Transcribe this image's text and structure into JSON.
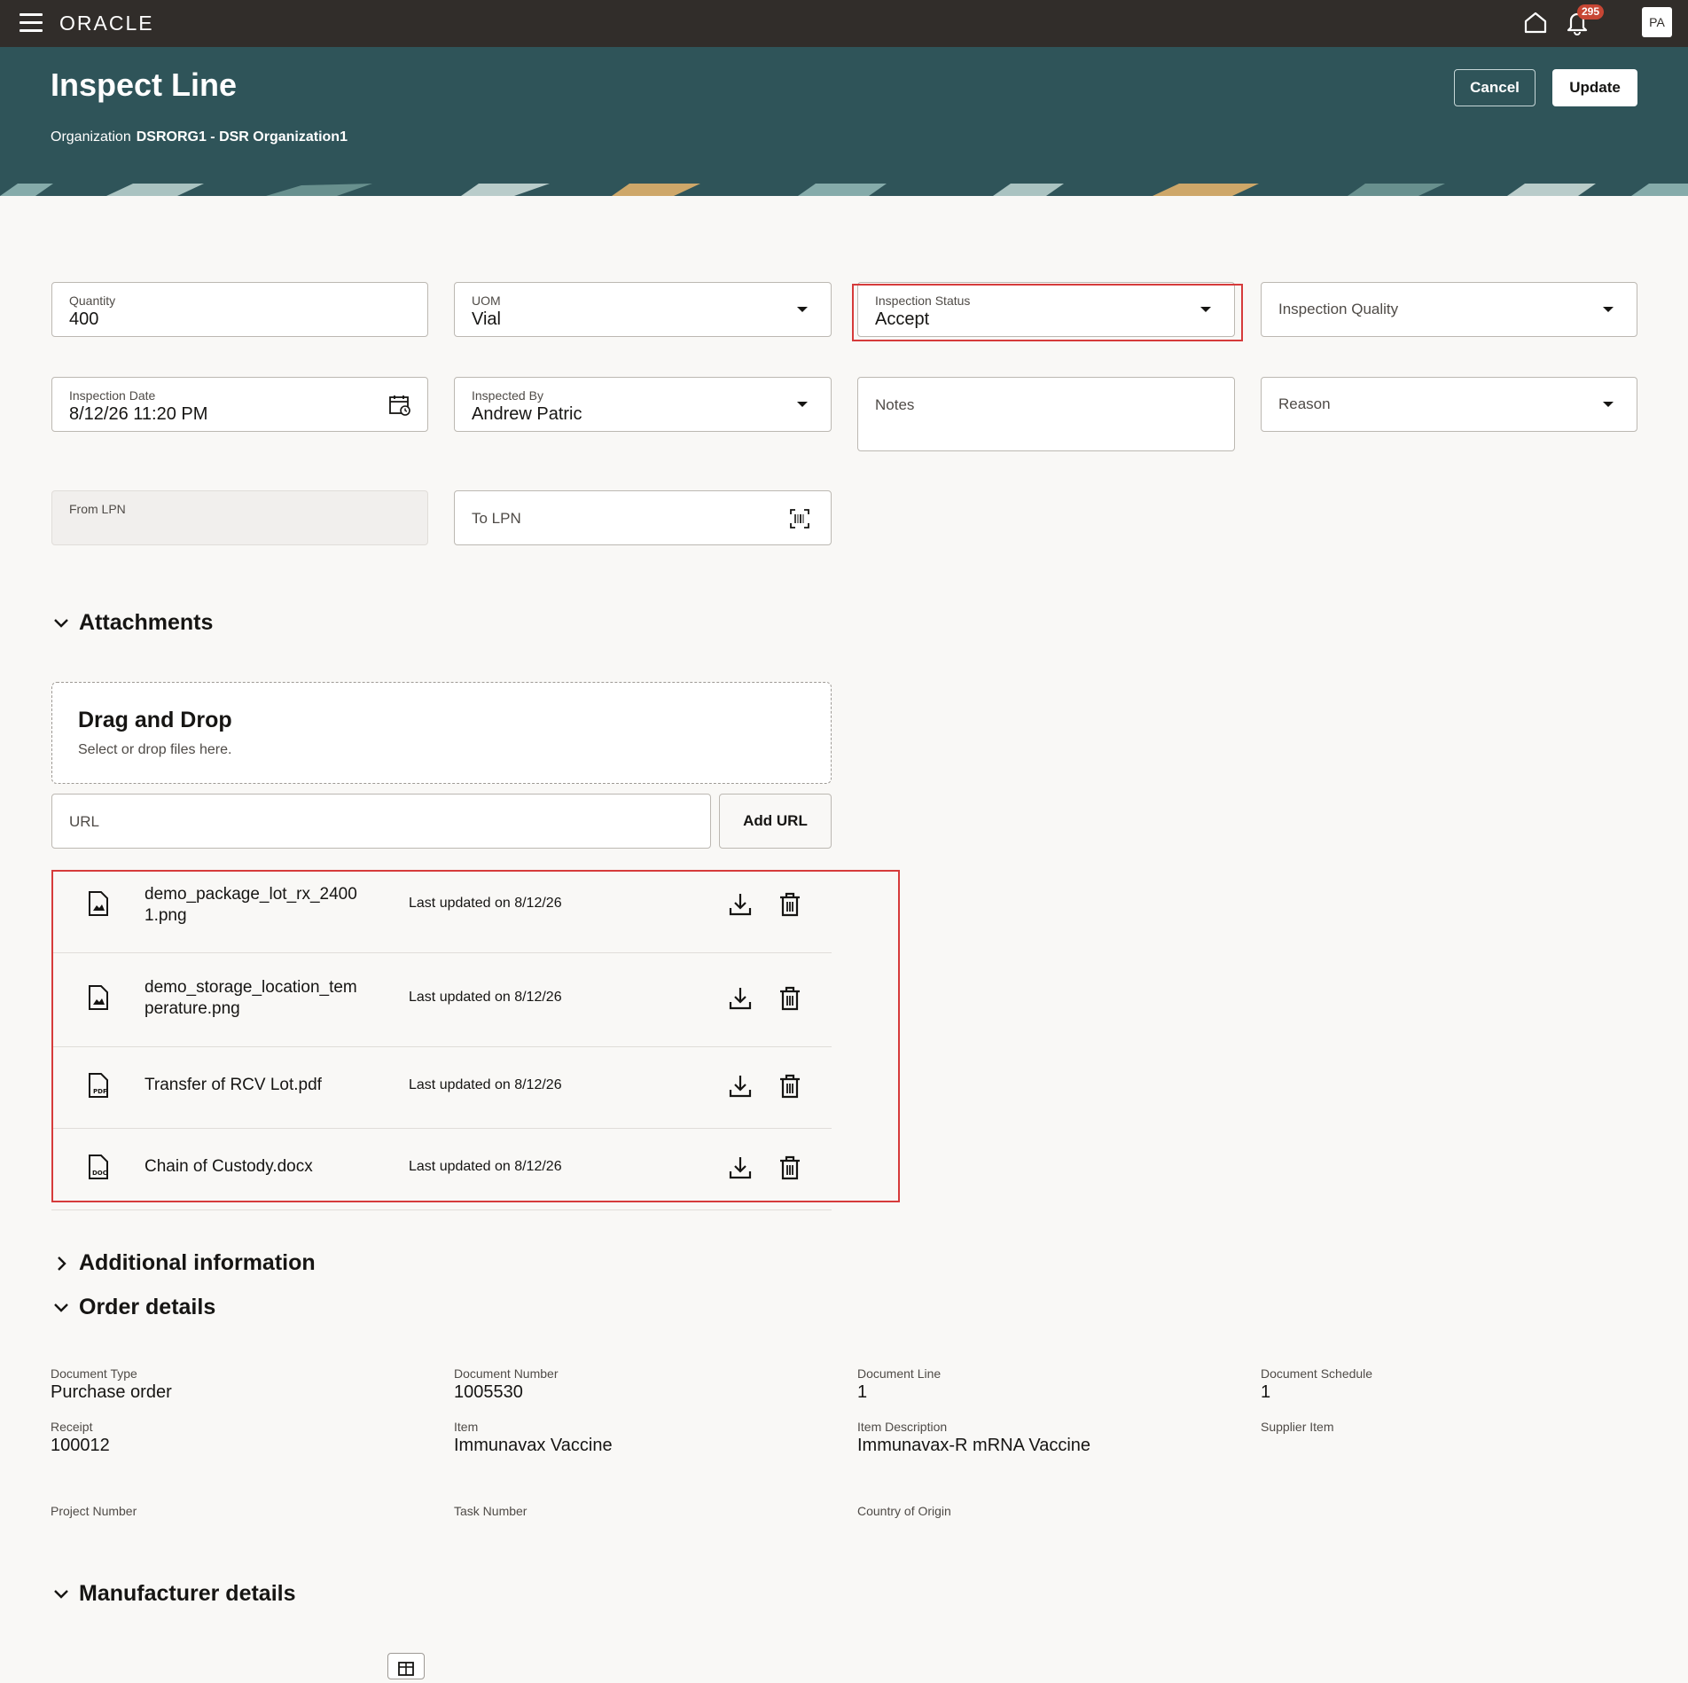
{
  "app": {
    "brand": "ORACLE",
    "notification_count": "295",
    "user_initials": "PA"
  },
  "header": {
    "title": "Inspect Line",
    "org_label": "Organization",
    "org_value": "DSRORG1 - DSR Organization1",
    "cancel_label": "Cancel",
    "update_label": "Update"
  },
  "form": {
    "quantity": {
      "label": "Quantity",
      "value": "400"
    },
    "uom": {
      "label": "UOM",
      "value": "Vial"
    },
    "inspection_status": {
      "label": "Inspection Status",
      "value": "Accept"
    },
    "inspection_quality": {
      "placeholder": "Inspection Quality"
    },
    "inspection_date": {
      "label": "Inspection Date",
      "value": "8/12/26 11:20 PM"
    },
    "inspected_by": {
      "label": "Inspected By",
      "value": "Andrew Patric"
    },
    "notes": {
      "placeholder": "Notes"
    },
    "reason": {
      "placeholder": "Reason"
    },
    "from_lpn": {
      "label": "From LPN"
    },
    "to_lpn": {
      "placeholder": "To LPN"
    }
  },
  "attachments": {
    "title": "Attachments",
    "drop_title": "Drag and Drop",
    "drop_subtitle": "Select or drop files here.",
    "url_placeholder": "URL",
    "add_url_label": "Add URL",
    "files": [
      {
        "name": "demo_package_lot_rx_24001.png",
        "updated": "Last updated on 8/12/26",
        "icon": "image-file-icon"
      },
      {
        "name": "demo_storage_location_temperature.png",
        "updated": "Last updated on 8/12/26",
        "icon": "image-file-icon"
      },
      {
        "name": "Transfer of RCV Lot.pdf",
        "updated": "Last updated on 8/12/26",
        "icon": "pdf-file-icon"
      },
      {
        "name": "Chain of Custody.docx",
        "updated": "Last updated on 8/12/26",
        "icon": "doc-file-icon"
      }
    ]
  },
  "sections": {
    "additional_info": "Additional information",
    "order_details": "Order details",
    "manufacturer_details": "Manufacturer details"
  },
  "order_details": {
    "document_type": {
      "label": "Document Type",
      "value": "Purchase order"
    },
    "document_number": {
      "label": "Document Number",
      "value": "1005530"
    },
    "document_line": {
      "label": "Document Line",
      "value": "1"
    },
    "document_schedule": {
      "label": "Document Schedule",
      "value": "1"
    },
    "receipt": {
      "label": "Receipt",
      "value": "100012"
    },
    "item": {
      "label": "Item",
      "value": "Immunavax Vaccine"
    },
    "item_description": {
      "label": "Item Description",
      "value": "Immunavax-R mRNA Vaccine"
    },
    "supplier_item": {
      "label": "Supplier Item",
      "value": ""
    },
    "project_number": {
      "label": "Project Number",
      "value": ""
    },
    "task_number": {
      "label": "Task Number",
      "value": ""
    },
    "country_of_origin": {
      "label": "Country of Origin",
      "value": ""
    }
  },
  "colors": {
    "topbar": "#312d2a",
    "header": "#2f5459",
    "highlight": "#d63b3b",
    "badge": "#c74634"
  }
}
